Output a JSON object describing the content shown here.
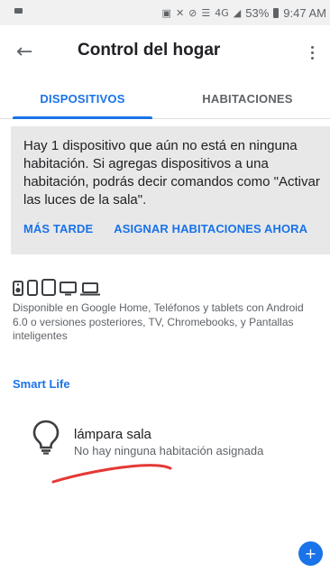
{
  "status_bar": {
    "battery": "53%",
    "time": "9:47 AM",
    "network": "4G"
  },
  "header": {
    "title": "Control del hogar"
  },
  "tabs": [
    {
      "label": "DISPOSITIVOS",
      "active": true
    },
    {
      "label": "HABITACIONES",
      "active": false
    }
  ],
  "banner": {
    "message": "Hay 1 dispositivo que aún no está en ninguna habitación. Si agregas dispositivos a una habitación, podrás decir comandos como \"Activar las luces de la sala\".",
    "later_label": "MÁS TARDE",
    "assign_label": "ASIGNAR HABITACIONES AHORA"
  },
  "availability": {
    "text": "Disponible en Google Home, Teléfonos y tablets con Android 6.0 o versiones posteriores, TV, Chromebooks, y Pantallas inteligentes"
  },
  "section": {
    "title": "Smart Life"
  },
  "devices": [
    {
      "name": "lámpara sala",
      "room": "No hay ninguna habitación asignada"
    }
  ],
  "fab": {
    "symbol": "+"
  },
  "colors": {
    "accent": "#1a73e8",
    "banner_bg": "#e8e8e8",
    "annotation_red": "#e53935"
  }
}
